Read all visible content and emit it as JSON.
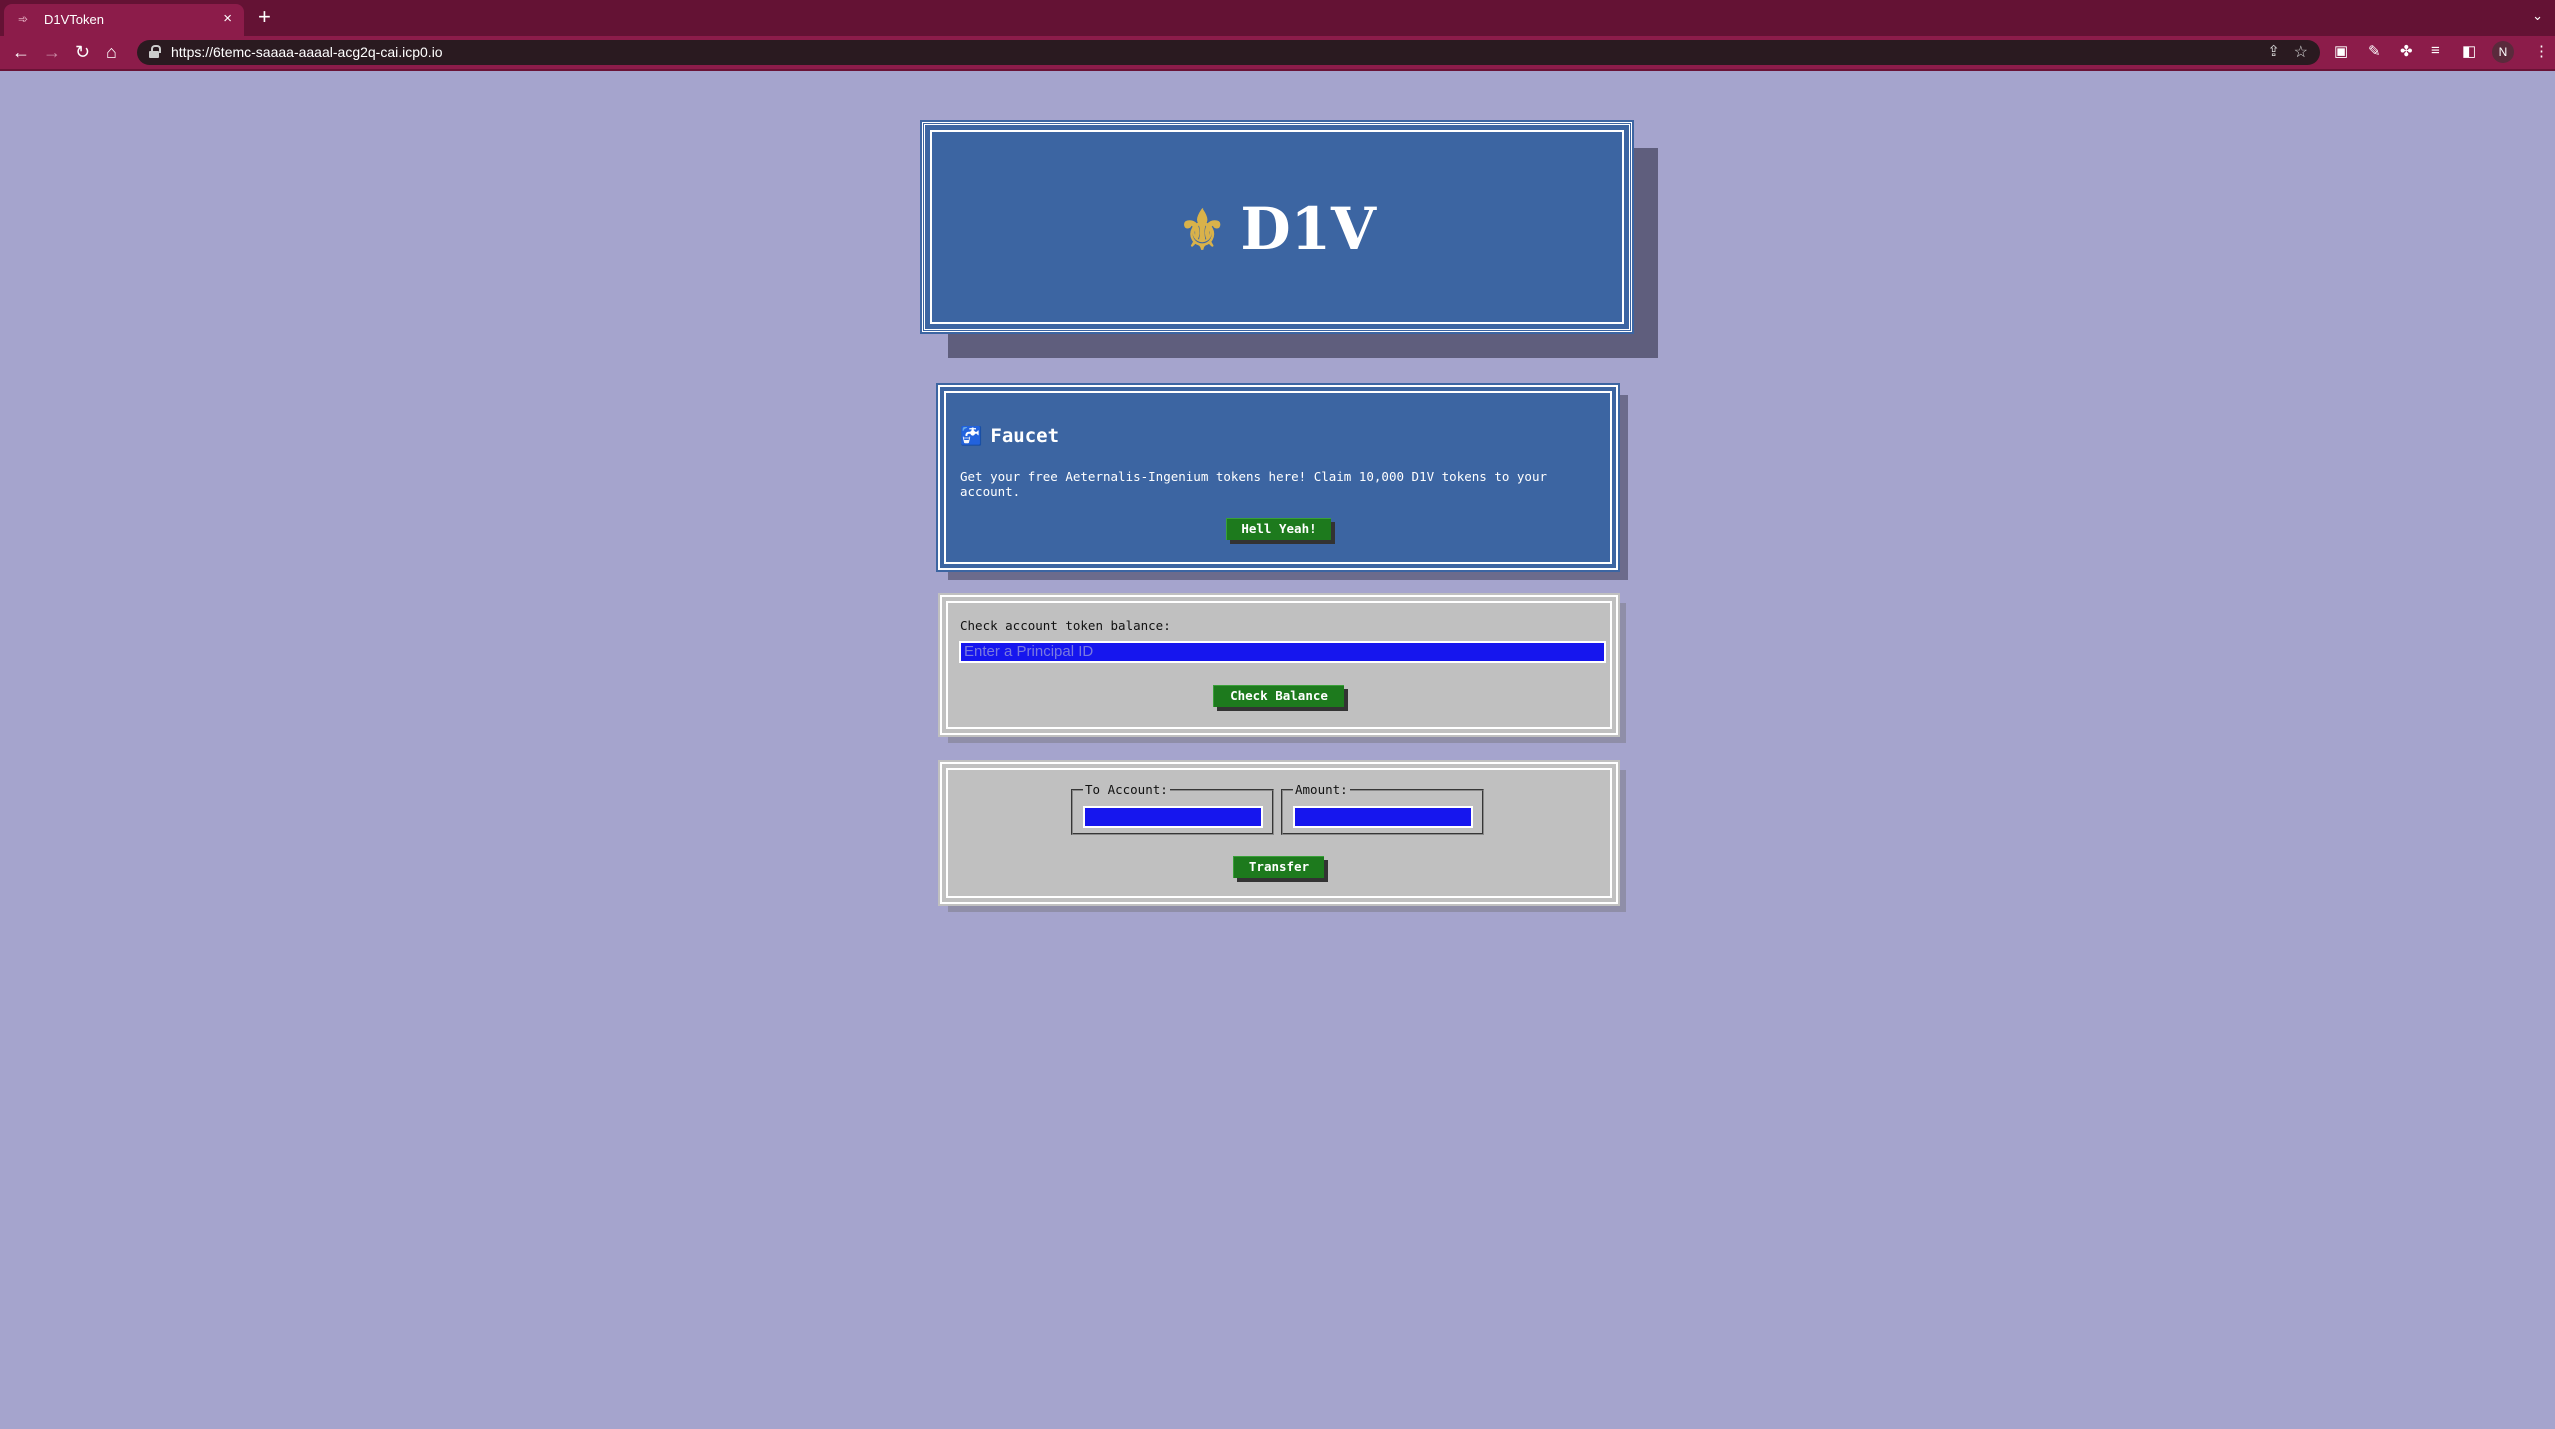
{
  "browser": {
    "tab_title": "D1VToken",
    "tab_icon": "link-icon",
    "close_glyph": "×",
    "new_tab_glyph": "+",
    "tab_menu_glyph": "⌄",
    "url": "https://6temc-saaaa-aaaal-acg2q-cai.icp0.io",
    "profile_initial": "N"
  },
  "header": {
    "logo_glyph": "⚜",
    "logo_text": "D1V"
  },
  "faucet": {
    "icon_glyph": "🚰",
    "title": "Faucet",
    "description": "Get your free Aeternalis-Ingenium tokens here! Claim 10,000 D1V tokens to your account.",
    "button_label": "Hell Yeah!"
  },
  "balance": {
    "label": "Check account token balance:",
    "input_placeholder": "Enter a Principal ID",
    "button_label": "Check Balance"
  },
  "transfer": {
    "to_account_label": "To Account:",
    "amount_label": "Amount:",
    "button_label": "Transfer"
  },
  "colors": {
    "page_bg": "#a5a4cd",
    "panel_blue": "#3c65a2",
    "panel_gray": "#c0c0c0",
    "button_green": "#1d7a1d",
    "input_blue": "#1616ee",
    "chrome_tab_bar": "#641234",
    "chrome_toolbar": "#8c1c4a"
  }
}
